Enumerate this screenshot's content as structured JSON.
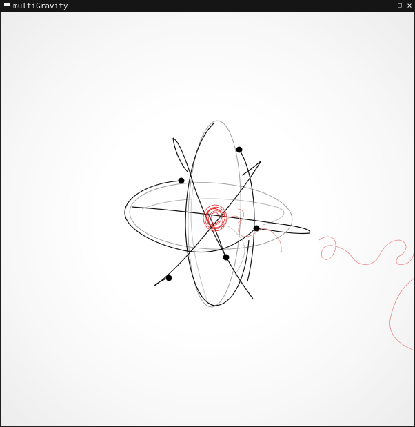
{
  "window": {
    "title": "multiGravity",
    "controls": {
      "minimize": "_",
      "maximize": "□",
      "close": "×"
    },
    "app_icon": "app-icon"
  },
  "simulation": {
    "background": "#ffffff",
    "trail_colors": {
      "orbit_dark": "#111111",
      "orbit_light": "#9a9a9a",
      "wander": "#e06a6a",
      "core": "#e53030"
    },
    "body_count": 5,
    "body_color": "#000000"
  }
}
